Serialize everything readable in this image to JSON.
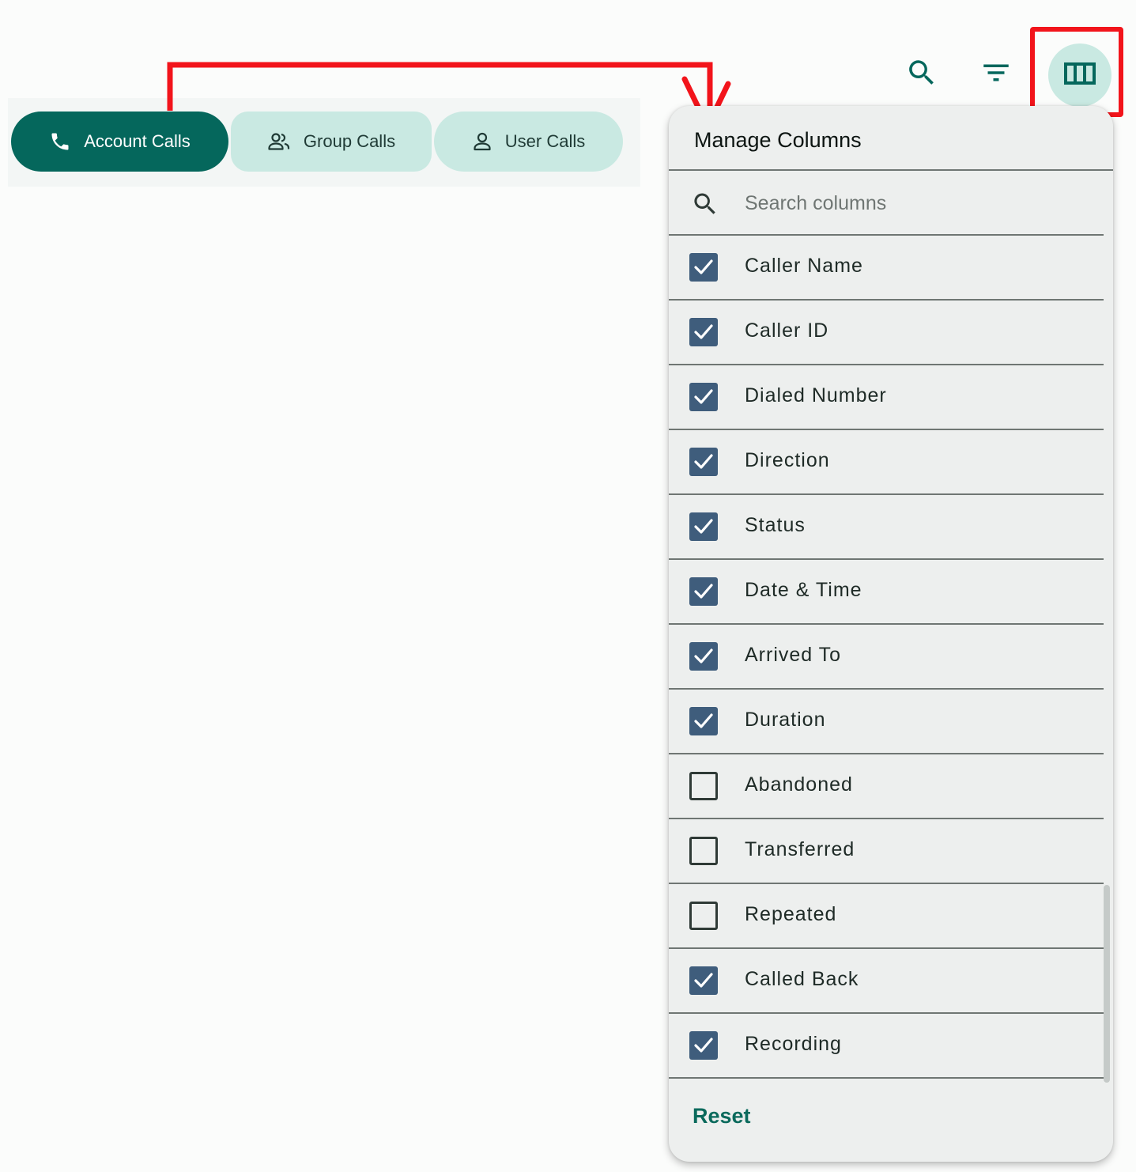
{
  "tabs": [
    {
      "label": "Account Calls",
      "icon": "phone-icon",
      "active": true
    },
    {
      "label": "Group Calls",
      "icon": "group-icon",
      "active": false
    },
    {
      "label": "User Calls",
      "icon": "person-icon",
      "active": false
    }
  ],
  "toolbar": {
    "search_icon": "search-icon",
    "filter_icon": "filter-icon",
    "columns_icon": "view-columns-icon"
  },
  "panel": {
    "title": "Manage Columns",
    "search_placeholder": "Search columns",
    "reset_label": "Reset",
    "columns": [
      {
        "label": "Caller Name",
        "checked": true
      },
      {
        "label": "Caller ID",
        "checked": true
      },
      {
        "label": "Dialed Number",
        "checked": true
      },
      {
        "label": "Direction",
        "checked": true
      },
      {
        "label": "Status",
        "checked": true
      },
      {
        "label": "Date & Time",
        "checked": true
      },
      {
        "label": "Arrived To",
        "checked": true
      },
      {
        "label": "Duration",
        "checked": true
      },
      {
        "label": "Abandoned",
        "checked": false
      },
      {
        "label": "Transferred",
        "checked": false
      },
      {
        "label": "Repeated",
        "checked": false
      },
      {
        "label": "Called Back",
        "checked": true
      },
      {
        "label": "Recording",
        "checked": true
      }
    ]
  },
  "colors": {
    "primary": "#05675c",
    "tab_inactive_bg": "#c9e9e2",
    "checkbox_checked": "#3f5d7c",
    "annotation_red": "#f2141b"
  }
}
